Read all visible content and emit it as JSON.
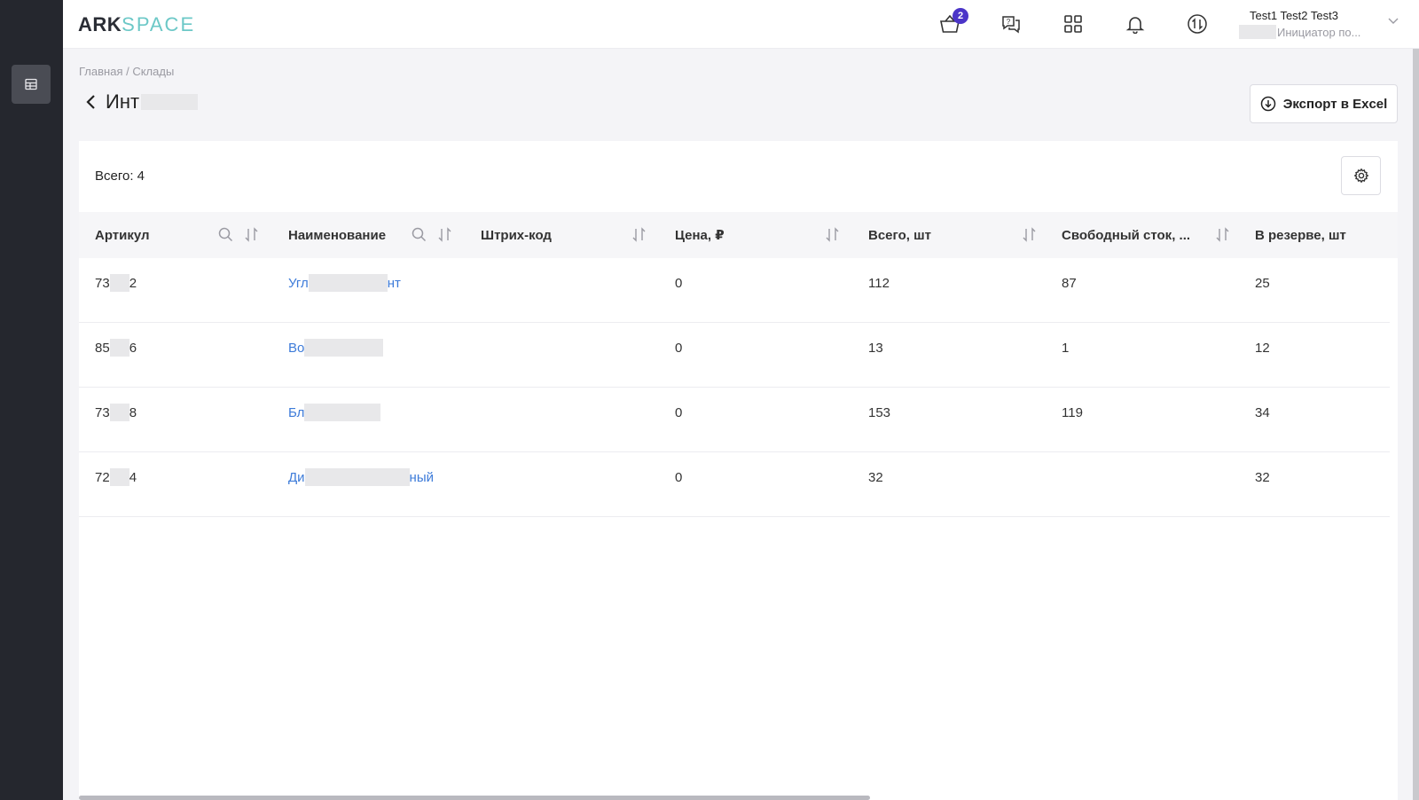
{
  "logo": {
    "part1": "ARK",
    "part2": "SPACE"
  },
  "topbar": {
    "cart_badge": "2",
    "icons": [
      "cart-icon",
      "help-chat-icon",
      "apps-grid-icon",
      "bell-icon",
      "exchange-icon"
    ],
    "user_name": "Test1 Test2 Test3",
    "user_role": "Инициатор по..."
  },
  "sidebar": {
    "active_icon": "table-icon"
  },
  "breadcrumb": "Главная / Склады",
  "page_title": "Инт",
  "export_label": "Экспорт в Excel",
  "total_label": "Всего: 4",
  "table": {
    "columns": [
      {
        "label": "Артикул",
        "search": true,
        "sort": true
      },
      {
        "label": "Наименование",
        "search": true,
        "sort": true
      },
      {
        "label": "Штрих-код",
        "search": false,
        "sort": true
      },
      {
        "label": "Цена, ₽",
        "search": false,
        "sort": true
      },
      {
        "label": "Всего, шт",
        "search": false,
        "sort": true
      },
      {
        "label": "Свободный сток, ...",
        "search": false,
        "sort": true
      },
      {
        "label": "В резерве, шт",
        "search": false,
        "sort": false
      }
    ],
    "rows": [
      {
        "sku_start": "73",
        "sku_end": "2",
        "name_start": "Угл",
        "name_end": "нт",
        "barcode": "",
        "price": "0",
        "total": "112",
        "free": "87",
        "reserved": "25"
      },
      {
        "sku_start": "85",
        "sku_end": "6",
        "name_start": "Во",
        "name_end": "",
        "barcode": "",
        "price": "0",
        "total": "13",
        "free": "1",
        "reserved": "12"
      },
      {
        "sku_start": "73",
        "sku_end": "8",
        "name_start": "Бл",
        "name_end": "",
        "barcode": "",
        "price": "0",
        "total": "153",
        "free": "119",
        "reserved": "34"
      },
      {
        "sku_start": "72",
        "sku_end": "4",
        "name_start": "Ди",
        "name_end": "ный",
        "barcode": "",
        "price": "0",
        "total": "32",
        "free": "",
        "reserved": "32"
      }
    ]
  },
  "colors": {
    "accent": "#4b35c8",
    "link": "#3d7bd9",
    "sidebar": "#25272e",
    "logo_space": "#6cc8c7"
  }
}
